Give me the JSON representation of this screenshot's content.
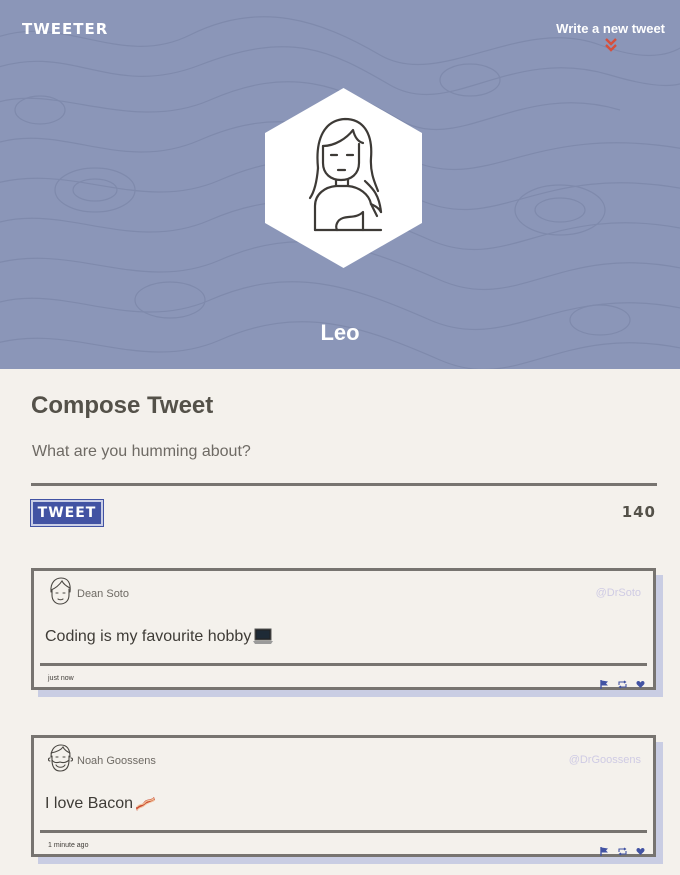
{
  "nav": {
    "logo": "TWEETER",
    "write_link": "Write a new tweet",
    "chevron_icon": "double-chevron-down-icon"
  },
  "profile": {
    "name": "Leo",
    "avatar_icon": "woman-avatar-icon"
  },
  "compose": {
    "title": "Compose Tweet",
    "placeholder": "What are you humming about?",
    "button_label": "TWEET",
    "counter": "140"
  },
  "tweets": [
    {
      "author": "Dean Soto",
      "handle": "@DrSoto",
      "text": "Coding is my favourite hobby",
      "emoji_icon": "laptop-icon",
      "time": "just now",
      "avatar_icon": "man-avatar-icon"
    },
    {
      "author": "Noah Goossens",
      "handle": "@DrGoossens",
      "text": "I love Bacon",
      "emoji_icon": "bacon-icon",
      "time": "1 minute ago",
      "avatar_icon": "bearded-man-avatar-icon"
    }
  ],
  "action_icons": [
    "flag-icon",
    "retweet-icon",
    "heart-icon"
  ],
  "colors": {
    "header_bg": "#8b96b8",
    "page_bg": "#f4f1ec",
    "accent": "#4253a3",
    "chevron": "#d64f3c",
    "shadow": "#c9cde3"
  }
}
